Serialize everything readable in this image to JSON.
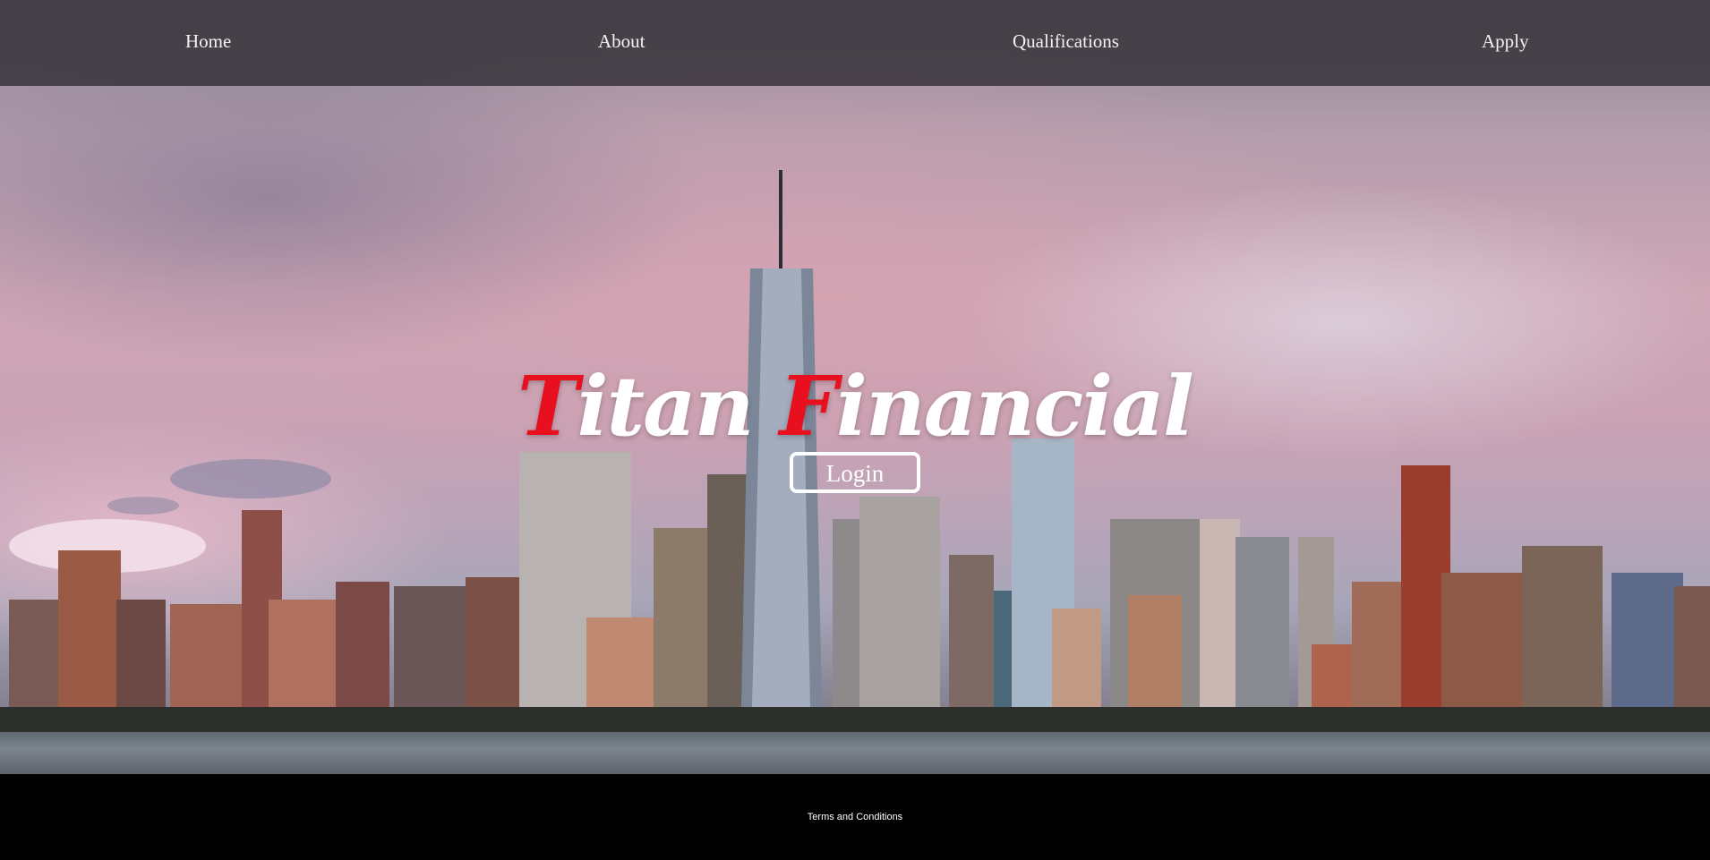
{
  "nav": {
    "items": [
      {
        "label": "Home"
      },
      {
        "label": "About"
      },
      {
        "label": "Qualifications"
      },
      {
        "label": "Apply"
      }
    ]
  },
  "hero": {
    "title_first_initial": "T",
    "title_first_rest": "itan ",
    "title_second_initial": "F",
    "title_second_rest": "inancial",
    "login_label": "Login"
  },
  "footer": {
    "terms_label": "Terms and Conditions"
  },
  "colors": {
    "accent": "#e8101e",
    "nav_bg": "#3a363c",
    "footer_bg": "#000000"
  }
}
